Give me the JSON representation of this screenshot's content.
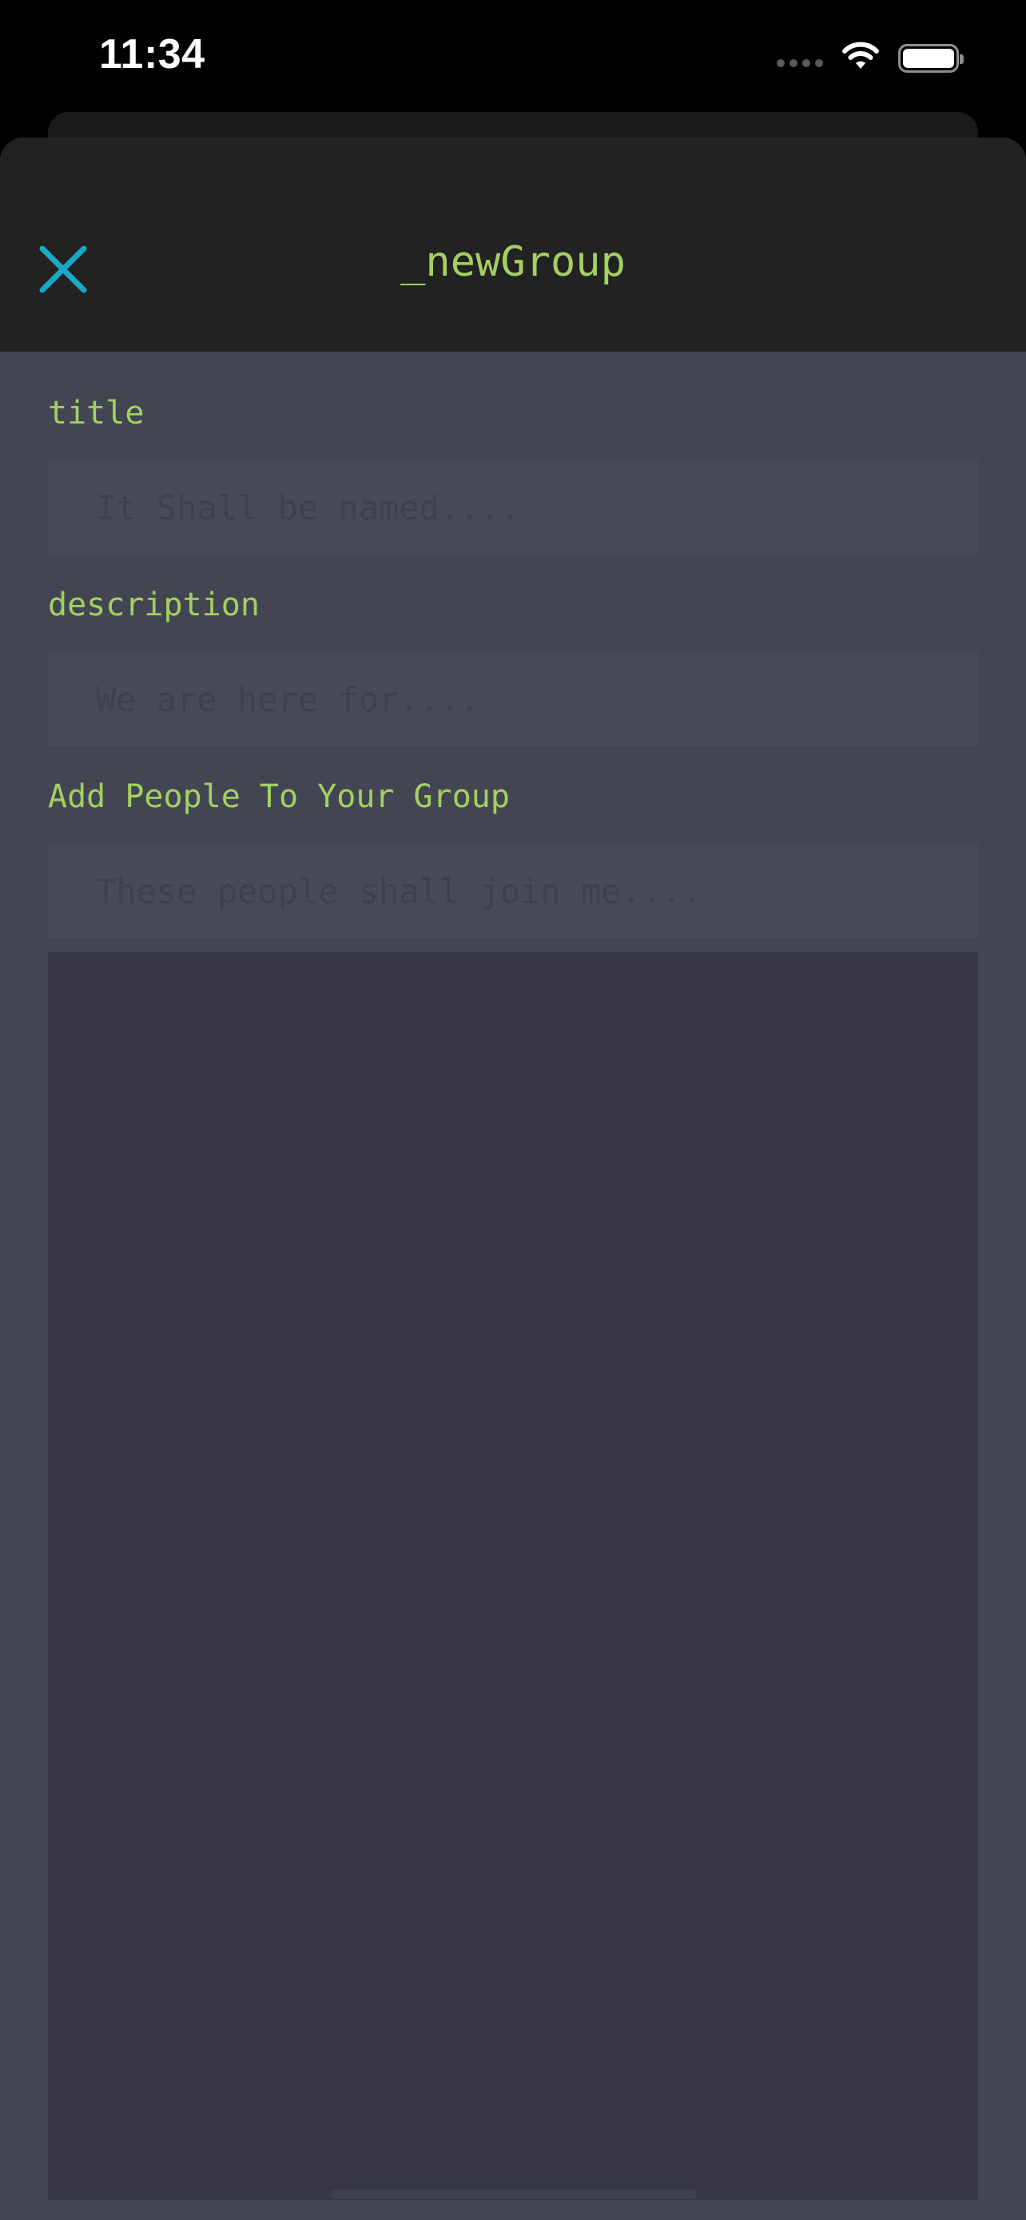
{
  "status_bar": {
    "time": "11:34",
    "wifi_icon": "wifi-icon",
    "battery_icon": "battery-icon"
  },
  "header": {
    "title": "_newGroup",
    "close_icon": "close-icon"
  },
  "form": {
    "title_label": "title",
    "title_placeholder": "It Shall be named....",
    "title_value": "",
    "description_label": "description",
    "description_placeholder": "We are here for....",
    "description_value": "",
    "people_label": "Add People To Your Group",
    "people_placeholder": "These people shall join me....",
    "people_value": ""
  },
  "people_list": {
    "items": []
  },
  "colors": {
    "accent_text": "#a3d061",
    "close_icon": "#1aa8c4",
    "header_bg": "#222222",
    "body_bg": "#434652",
    "list_bg": "#363743"
  }
}
